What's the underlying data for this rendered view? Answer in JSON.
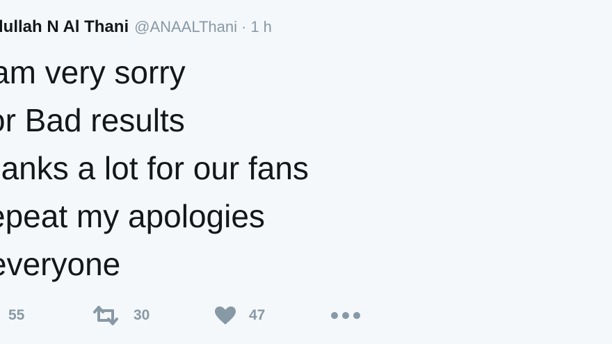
{
  "tweet": {
    "display_name": "dullah N Al Thani",
    "handle": "@ANAALThani",
    "separator": "·",
    "time": "1 h",
    "lines": [
      "am very sorry",
      "or Bad results",
      "hanks a lot for our fans",
      "epeat my apologies",
      " everyone"
    ],
    "actions": {
      "replies": "55",
      "retweets": "30",
      "likes": "47",
      "reply_icon": "reply-icon",
      "retweet_icon": "retweet-icon",
      "like_icon": "heart-icon",
      "more_icon": "more-icon"
    }
  },
  "colors": {
    "background": "#f5f8fa",
    "text": "#14171a",
    "muted": "#8899a6"
  }
}
